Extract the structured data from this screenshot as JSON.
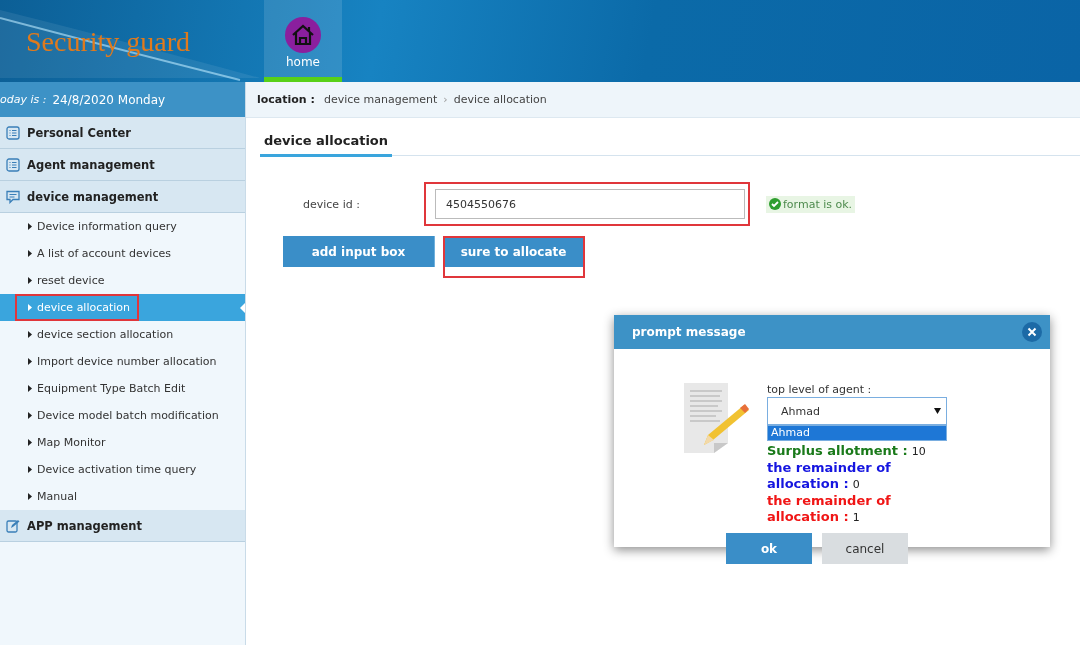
{
  "header": {
    "logo": "Security guard",
    "nav": [
      {
        "label": "home",
        "selected": true
      }
    ]
  },
  "date_bar": {
    "label": "oday is :",
    "date": "24/8/2020 Monday"
  },
  "sidebar": {
    "sections": [
      {
        "label": "Personal Center",
        "kind": "list"
      },
      {
        "label": "Agent management",
        "kind": "list"
      },
      {
        "label": "device management",
        "kind": "chat",
        "children": [
          {
            "label": "Device information query",
            "selected": false,
            "highlighted": false
          },
          {
            "label": "A list of account devices",
            "selected": false,
            "highlighted": false
          },
          {
            "label": "reset device",
            "selected": false,
            "highlighted": false
          },
          {
            "label": "device allocation",
            "selected": true,
            "highlighted": true
          },
          {
            "label": "device section allocation",
            "selected": false,
            "highlighted": false
          },
          {
            "label": "Import device number allocation",
            "selected": false,
            "highlighted": false
          },
          {
            "label": "Equipment Type Batch Edit",
            "selected": false,
            "highlighted": false
          },
          {
            "label": "Device model batch modification",
            "selected": false,
            "highlighted": false
          },
          {
            "label": "Map Monitor",
            "selected": false,
            "highlighted": false
          },
          {
            "label": "Device activation time query",
            "selected": false,
            "highlighted": false
          },
          {
            "label": "Manual",
            "selected": false,
            "highlighted": false
          }
        ]
      },
      {
        "label": "APP management",
        "kind": "edit"
      }
    ]
  },
  "breadcrumb": {
    "label": "location :",
    "path": [
      "device management",
      "device allocation"
    ],
    "separator": "›"
  },
  "panel": {
    "title": "device allocation",
    "field": {
      "label": "device id :",
      "value": "4504550676",
      "highlighted": true
    },
    "validation": "format is ok.",
    "buttons": [
      {
        "label": "add input box",
        "highlighted": false
      },
      {
        "label": "sure to allocate",
        "highlighted": true
      }
    ]
  },
  "dialog": {
    "title": "prompt message",
    "select_label": "top level of agent :",
    "select_value": "Ahmad",
    "dropdown_options": [
      {
        "label": "Ahmad",
        "selected": true
      }
    ],
    "lines": [
      {
        "label": "Surplus allotment  :",
        "value": "10",
        "color": "#1a7a1a"
      },
      {
        "label": "the remainder of allocation :",
        "value": "0",
        "color": "#1515e0"
      },
      {
        "label": "the remainder of allocation  :",
        "value": "1",
        "color": "#f01515"
      }
    ],
    "buttons": [
      {
        "label": "ok",
        "kind": "primary"
      },
      {
        "label": "cancel",
        "kind": "secondary"
      }
    ]
  }
}
